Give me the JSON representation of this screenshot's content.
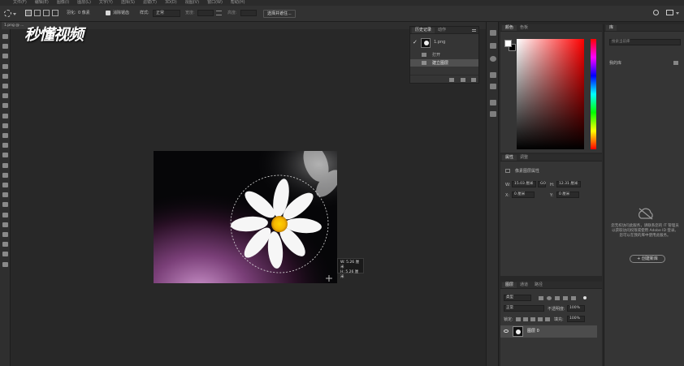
{
  "menubar": {
    "items": [
      "文件(F)",
      "编辑(E)",
      "图像(I)",
      "图层(L)",
      "文字(Y)",
      "选择(S)",
      "滤镜(T)",
      "3D(D)",
      "视图(V)",
      "窗口(W)",
      "帮助(H)"
    ]
  },
  "options": {
    "feather_label": "羽化:",
    "feather_value": "0 像素",
    "antialias_label": "消除锯齿",
    "style_label": "样式:",
    "style_value": "正常",
    "width_label": "宽度:",
    "height_label": "高度:",
    "select_mask_button": "选择并遮住..."
  },
  "document": {
    "tab_label": "1.png @ ..."
  },
  "watermark": {
    "text": "秒懂视频"
  },
  "size_tooltip": {
    "w": "W: 5.26 厘米",
    "h": "H: 5.26 厘米"
  },
  "history": {
    "tab_history": "历史记录",
    "tab_actions": "动作",
    "snapshot_name": "1.png",
    "items": [
      "打开",
      "建立图层"
    ]
  },
  "color": {
    "tab_color": "颜色",
    "tab_swatches": "色板",
    "accent": "#ff0000"
  },
  "properties": {
    "tab_properties": "属性",
    "tab_adjustments": "调整",
    "layer_type": "像素图层属性",
    "w_label": "W:",
    "w_value": "15.03 厘米",
    "link_label": "GO",
    "h_label": "H:",
    "h_value": "12.31 厘米",
    "x_label": "X:",
    "x_value": "0 厘米",
    "y_label": "Y:",
    "y_value": "0 厘米"
  },
  "layers": {
    "tab_layers": "图层",
    "tab_channels": "通道",
    "tab_paths": "路径",
    "kind_filter": "类型",
    "blend_mode": "正常",
    "opacity_label": "不透明度:",
    "opacity_value": "100%",
    "lock_label": "锁定:",
    "fill_label": "填充:",
    "fill_value": "100%",
    "layer_name": "图层 0"
  },
  "learn": {
    "tab": "库",
    "search_placeholder": "搜索当前库",
    "library_label": "我的库",
    "message": "您无权访问此服务，请联系您的 IT 管理员以获取访问权限或使用 Adobe ID 登录。您可以在我的库中使用此服务。",
    "create_button": "+ 创建新库"
  }
}
